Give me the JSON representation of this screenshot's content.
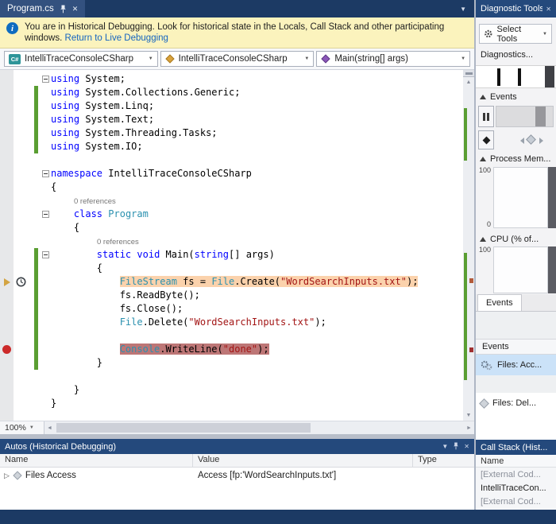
{
  "icons": {
    "dropdown": "▼",
    "close": "✕",
    "info": "i",
    "csharp": "C#",
    "up_arrow": "▲",
    "down_arrow": "▼",
    "left_arrow": "◄",
    "right_arrow": "►",
    "expander": "▷"
  },
  "colors": {
    "title_bar_blue": "#24497c",
    "tab_strip_blue": "#1c3a64",
    "infobar_yellow": "#fbf3bd",
    "link_blue": "#1464c0",
    "keyword_blue": "#0000ff",
    "type_teal": "#2b91af",
    "string_red": "#a31515",
    "codelens_gray": "#767676",
    "current_line_highlight": "#fbd2ac",
    "breakpoint_line_highlight": "#bd7676",
    "breakpoint_red": "#cc2a2a",
    "change_bar_green": "#5a9e32",
    "selection_blue": "#cbe2f8"
  },
  "tab": {
    "title": "Program.cs"
  },
  "infobar": {
    "message": "You are in Historical Debugging. Look for historical state in the Locals, Call Stack and other participating windows.",
    "link_label": "Return to Live Debugging"
  },
  "navbar": {
    "project": "IntelliTraceConsoleCSharp",
    "type": "IntelliTraceConsoleCSharp",
    "member": "Main(string[] args)"
  },
  "editor": {
    "zoom": "100%",
    "lines": [
      {
        "fold": true,
        "segs": [
          [
            "using",
            "k"
          ],
          [
            " System;",
            "p"
          ]
        ]
      },
      {
        "cb": true,
        "segs": [
          [
            "using",
            "k"
          ],
          [
            " System.Collections.Generic;",
            "p"
          ]
        ]
      },
      {
        "cb": true,
        "segs": [
          [
            "using",
            "k"
          ],
          [
            " System.Linq;",
            "p"
          ]
        ]
      },
      {
        "cb": true,
        "segs": [
          [
            "using",
            "k"
          ],
          [
            " System.Text;",
            "p"
          ]
        ]
      },
      {
        "cb": true,
        "segs": [
          [
            "using",
            "k"
          ],
          [
            " System.Threading.Tasks;",
            "p"
          ]
        ]
      },
      {
        "cb": true,
        "segs": [
          [
            "using",
            "k"
          ],
          [
            " System.IO;",
            "p"
          ]
        ]
      },
      {
        "segs": []
      },
      {
        "fold": true,
        "segs": [
          [
            "namespace",
            "k"
          ],
          [
            " IntelliTraceConsoleCSharp",
            "p"
          ]
        ]
      },
      {
        "segs": [
          [
            "{",
            "p"
          ]
        ]
      },
      {
        "pad": 29,
        "segs": [
          [
            "0 references",
            "c"
          ]
        ]
      },
      {
        "fold": true,
        "segs": [
          [
            "    ",
            "p"
          ],
          [
            "class",
            "k"
          ],
          [
            " ",
            "p"
          ],
          [
            "Program",
            "t"
          ]
        ]
      },
      {
        "segs": [
          [
            "    {",
            "p"
          ]
        ]
      },
      {
        "pad": 58,
        "segs": [
          [
            "0 references",
            "c"
          ]
        ]
      },
      {
        "fold": true,
        "cb": true,
        "segs": [
          [
            "        ",
            "p"
          ],
          [
            "static",
            "k"
          ],
          [
            " ",
            "p"
          ],
          [
            "void",
            "k"
          ],
          [
            " Main(",
            "p"
          ],
          [
            "string",
            "k"
          ],
          [
            "[] args)",
            "p"
          ]
        ]
      },
      {
        "cb": true,
        "segs": [
          [
            "        {",
            "p"
          ]
        ]
      },
      {
        "cb": true,
        "m": "hist",
        "lead": "            ",
        "hl": "cur",
        "segs": [
          [
            "FileStream",
            "t"
          ],
          [
            " fs = ",
            "p"
          ],
          [
            "File",
            "t"
          ],
          [
            ".Create(",
            "p"
          ],
          [
            "\"WordSearchInputs.txt\"",
            "s"
          ],
          [
            ");",
            "p"
          ]
        ]
      },
      {
        "cb": true,
        "segs": [
          [
            "            fs.ReadByte();",
            "p"
          ]
        ]
      },
      {
        "cb": true,
        "segs": [
          [
            "            fs.Close();",
            "p"
          ]
        ]
      },
      {
        "cb": true,
        "segs": [
          [
            "            ",
            "p"
          ],
          [
            "File",
            "t"
          ],
          [
            ".Delete(",
            "p"
          ],
          [
            "\"WordSearchInputs.txt\"",
            "s"
          ],
          [
            ");",
            "p"
          ]
        ]
      },
      {
        "cb": true,
        "segs": []
      },
      {
        "cb": true,
        "m": "bp",
        "lead": "            ",
        "hl": "bp",
        "segs": [
          [
            "Console",
            "t"
          ],
          [
            ".WriteLine(",
            "p"
          ],
          [
            "\"done\"",
            "s"
          ],
          [
            ");",
            "p"
          ]
        ]
      },
      {
        "cb": true,
        "segs": [
          [
            "        }",
            "p"
          ]
        ]
      },
      {
        "segs": []
      },
      {
        "segs": [
          [
            "    }",
            "p"
          ]
        ]
      },
      {
        "segs": [
          [
            "}",
            "p"
          ]
        ]
      }
    ]
  },
  "diagnostics": {
    "title": "Diagnostic Tools",
    "select_tools_label": "Select Tools",
    "session_label": "Diagnostics...",
    "events_section_label": "Events",
    "memory_section_label": "Process Mem...",
    "cpu_section_label": "CPU (% of...",
    "memory_scale_top": "100",
    "memory_scale_bottom": "0",
    "cpu_scale_top": "100",
    "events_tab_label": "Events",
    "events_list_header": "Events",
    "event_rows": [
      {
        "label": "Files: Acc...",
        "icon": "gears",
        "selected": true
      },
      {
        "label": "Files: Del...",
        "icon": "diamond",
        "selected": false
      }
    ]
  },
  "autos": {
    "title": "Autos (Historical Debugging)",
    "columns": [
      "Name",
      "Value",
      "Type"
    ],
    "rows": [
      {
        "name": "Files Access",
        "value": "Access [fp:'WordSearchInputs.txt']",
        "type": ""
      }
    ]
  },
  "callstack": {
    "title": "Call Stack (Hist...",
    "column": "Name",
    "rows": [
      {
        "label": "[External Cod...",
        "dim": true
      },
      {
        "label": "IntelliTraceCon...",
        "dim": false
      },
      {
        "label": "[External Cod...",
        "dim": true
      }
    ]
  }
}
